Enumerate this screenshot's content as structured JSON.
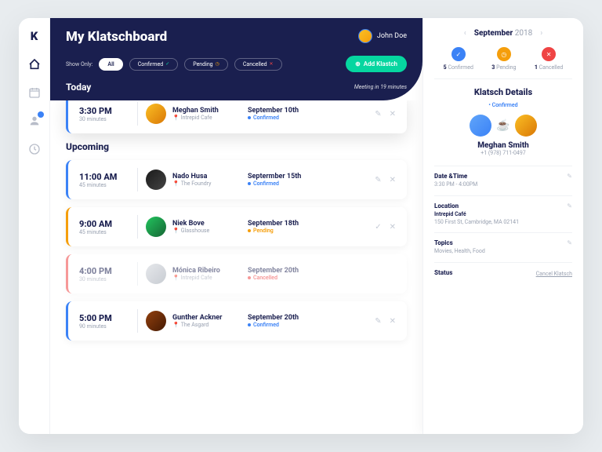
{
  "brand": "K",
  "header": {
    "title": "My Klatschboard",
    "user_name": "John Doe",
    "filter_label": "Show Only:",
    "filters": {
      "all": "All",
      "confirmed": "Confirmed",
      "pending": "Pending",
      "cancelled": "Cancelled"
    },
    "add_button": "Add Klastch",
    "today_label": "Today",
    "meeting_note": "Meeting in 19 minutes"
  },
  "today": {
    "time": "3:30 PM",
    "duration": "30 minutes",
    "name": "Meghan Smith",
    "location": "Intrepid Cafe",
    "date": "September 10th",
    "status": "Confirmed"
  },
  "upcoming_label": "Upcoming",
  "upcoming": [
    {
      "time": "11:00 AM",
      "duration": "45 minutes",
      "name": "Nado Husa",
      "location": "The Foundry",
      "date": "Septermber 15th",
      "status": "Confirmed",
      "color": "blue",
      "av": "b"
    },
    {
      "time": "9:00 AM",
      "duration": "45 minutes",
      "name": "Niek Bove",
      "location": "Glasshouse",
      "date": "September 18th",
      "status": "Pending",
      "color": "orange",
      "av": "c"
    },
    {
      "time": "4:00 PM",
      "duration": "30 minutes",
      "name": "Mónica Ribeiro",
      "location": "Intrepid Cafe",
      "date": "September 20th",
      "status": "Cancelled",
      "color": "red",
      "av": "d"
    },
    {
      "time": "5:00 PM",
      "duration": "90 minutes",
      "name": "Gunther Ackner",
      "location": "The Asgard",
      "date": "September 20th",
      "status": "Confirmed",
      "color": "blue",
      "av": "e"
    }
  ],
  "details": {
    "month": "September",
    "year": "2018",
    "stats": {
      "confirmed_n": "5",
      "confirmed_l": "Confirmed",
      "pending_n": "3",
      "pending_l": "Pending",
      "cancelled_n": "1",
      "cancelled_l": "Cancelled"
    },
    "title": "Klatsch Details",
    "status": "• Confirmed",
    "name": "Meghan Smith",
    "phone": "+1 (978) 711-0497",
    "datetime_label": "Date &Time",
    "datetime_value": "3:30 PM - 4:00PM",
    "location_label": "Location",
    "location_name": "Intrepid Café",
    "location_addr": "150 First St, Cambridge, MA 02141",
    "topics_label": "Topics",
    "topics_value": "Movies, Health, Food",
    "status_label": "Status",
    "cancel_link": "Cancel Klatsch"
  }
}
